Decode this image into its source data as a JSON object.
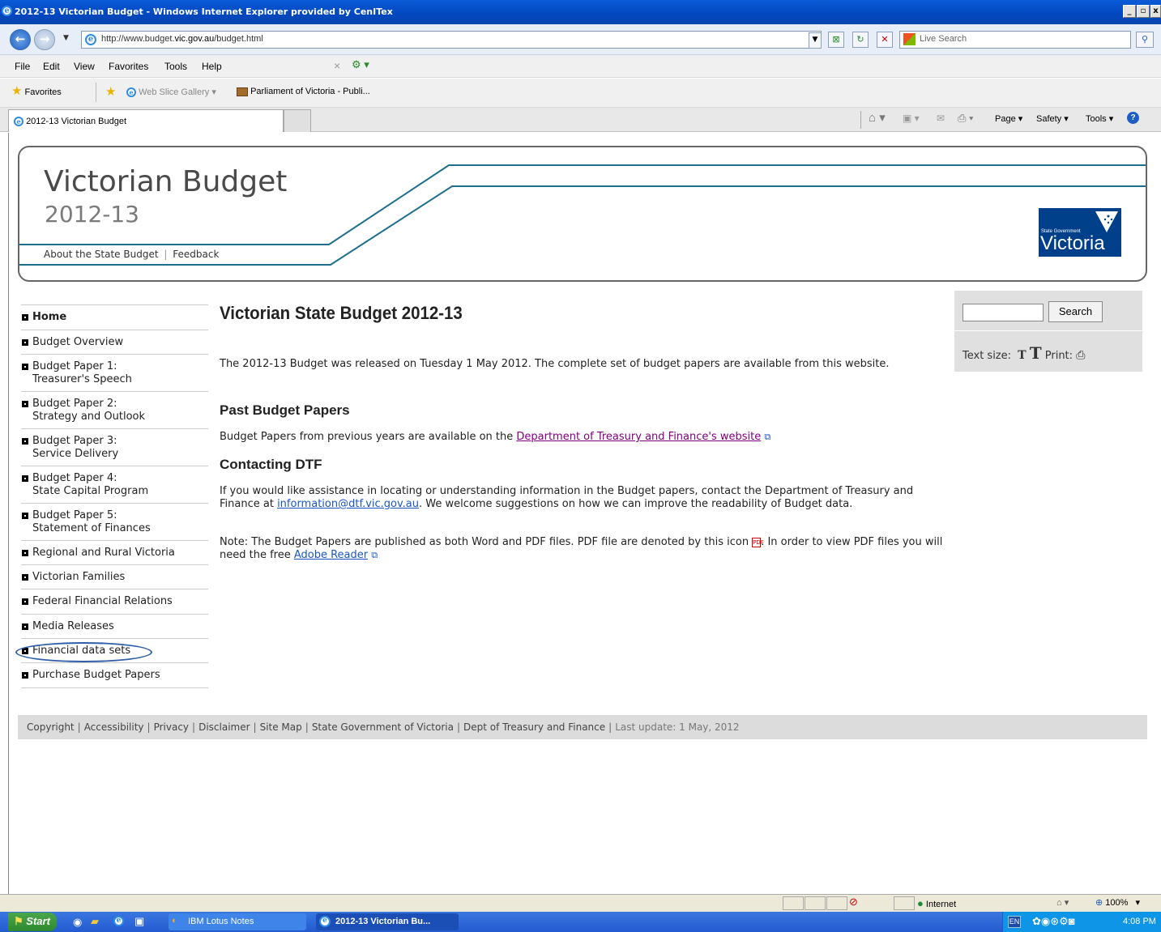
{
  "window": {
    "title": "2012-13 Victorian Budget - Windows Internet Explorer provided by CenITex",
    "controls": [
      "_",
      "▫",
      "x"
    ]
  },
  "address": {
    "url_prefix": "http://www.budget.",
    "url_domain": "vic.gov.au",
    "url_suffix": "/budget.html",
    "search_placeholder": "Live Search"
  },
  "menu": {
    "items": [
      "File",
      "Edit",
      "View",
      "Favorites",
      "Tools",
      "Help"
    ]
  },
  "favorites_bar": {
    "favorites_label": "Favorites",
    "items": [
      "Web Slice Gallery ▾",
      "Parliament of Victoria - Publi..."
    ]
  },
  "tabs": {
    "active_label": "2012-13 Victorian Budget"
  },
  "command_bar": {
    "items": [
      "Page ▾",
      "Safety ▾",
      "Tools ▾"
    ]
  },
  "site": {
    "title": "Victorian Budget",
    "year": "2012-13",
    "header_links": [
      "About the State Budget",
      "Feedback"
    ],
    "logo_small": "State Government",
    "logo_big": "Victoria"
  },
  "nav": {
    "items": [
      {
        "label": "Home"
      },
      {
        "label": "Budget Overview"
      },
      {
        "label": "Budget Paper 1:",
        "label2": "Treasurer's Speech"
      },
      {
        "label": "Budget Paper 2:",
        "label2": "Strategy and Outlook"
      },
      {
        "label": "Budget Paper 3:",
        "label2": "Service Delivery"
      },
      {
        "label": "Budget Paper 4:",
        "label2": "State Capital Program"
      },
      {
        "label": "Budget Paper 5:",
        "label2": "Statement of Finances"
      },
      {
        "label": "Regional and Rural Victoria"
      },
      {
        "label": "Victorian Families"
      },
      {
        "label": "Federal Financial Relations"
      },
      {
        "label": "Media Releases"
      },
      {
        "label": "Financial data sets"
      },
      {
        "label": "Purchase Budget Papers"
      }
    ]
  },
  "main": {
    "title": "Victorian State Budget 2012-13",
    "intro": "The 2012-13 Budget was released on Tuesday 1 May 2012. The complete set of budget papers are available from this website.",
    "past_heading": "Past Budget Papers",
    "past_text": "Budget Papers from previous years are available on the ",
    "past_link": "Department of Treasury and Finance's website",
    "contact_heading": "Contacting DTF",
    "contact_text_1": "If you would like assistance in locating or understanding information in the Budget papers, contact the Department of Treasury and Finance at ",
    "contact_email": "information@dtf.vic.gov.au",
    "contact_text_2": ". We welcome suggestions on how we can improve the readability of Budget data.",
    "note_text_1": "Note: The Budget Papers are published as both Word and PDF files. PDF file are denoted by this icon ",
    "note_text_2": ". In order to view PDF files you will need the free ",
    "note_link": "Adobe Reader"
  },
  "side": {
    "search_button": "Search",
    "text_size_label": "Text size:",
    "text_size_small": "T",
    "text_size_large": "T",
    "print_label": "Print:"
  },
  "footer": {
    "links": [
      "Copyright",
      "Accessibility",
      "Privacy",
      "Disclaimer",
      "Site Map",
      "State Government of Victoria",
      "Dept of Treasury and Finance"
    ],
    "last_update": "Last update: 1 May, 2012"
  },
  "status": {
    "zone": "Internet",
    "zoom": "100%"
  },
  "taskbar": {
    "start": "Start",
    "tasks": [
      "IBM Lotus Notes",
      "2012-13 Victorian Bu..."
    ],
    "lang": "EN",
    "clock": "4:08 PM"
  }
}
